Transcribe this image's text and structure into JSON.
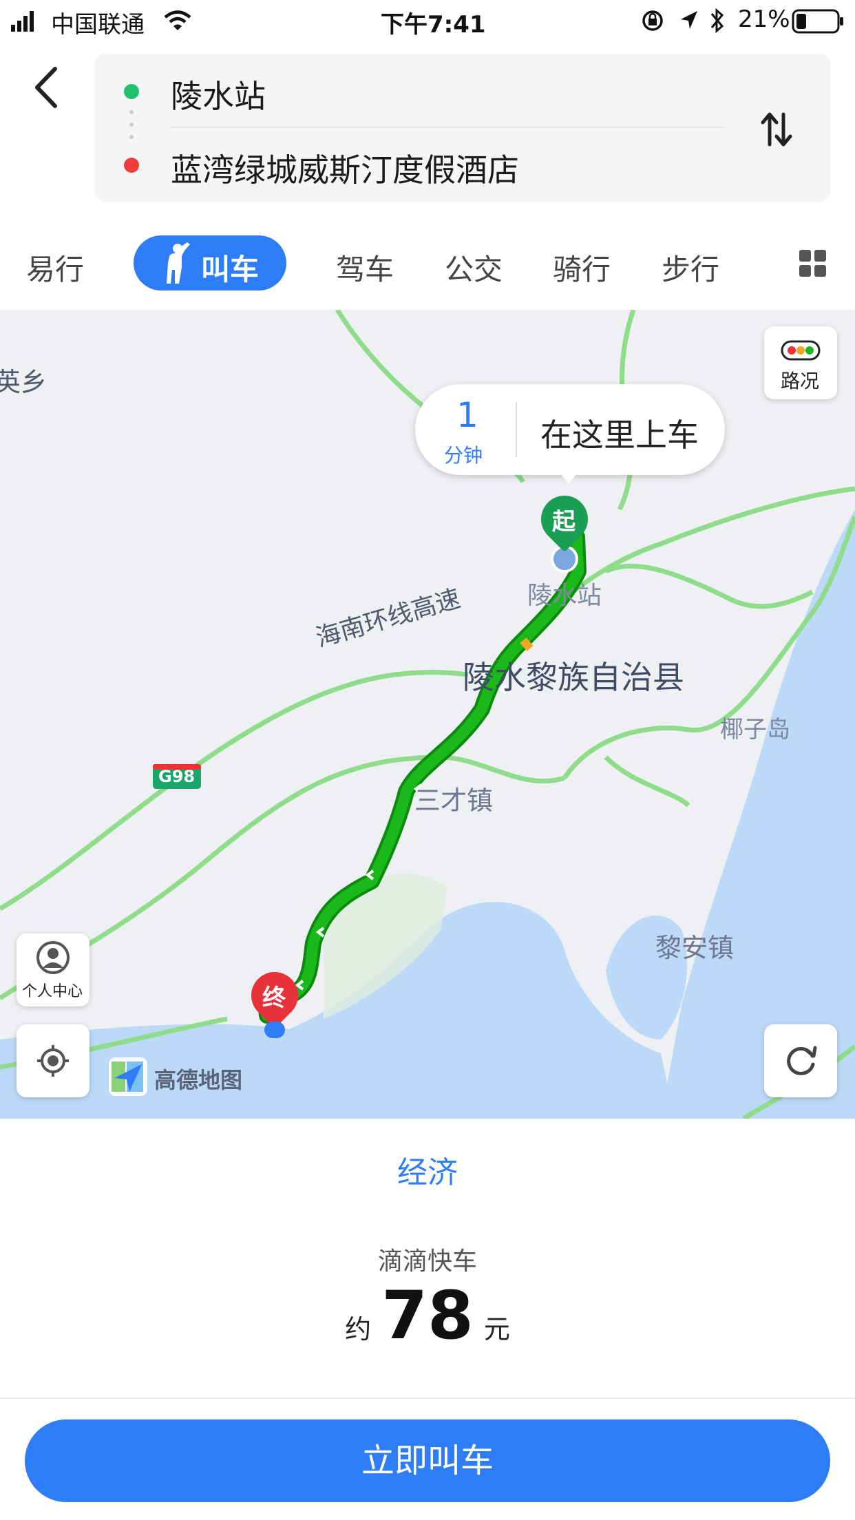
{
  "status_bar": {
    "carrier": "中国联通",
    "time": "下午7:41",
    "battery": "21%"
  },
  "route": {
    "origin": "陵水站",
    "destination": "蓝湾绿城威斯汀度假酒店"
  },
  "tabs": [
    {
      "label": "易行"
    },
    {
      "label": "叫车",
      "active": true
    },
    {
      "label": "驾车"
    },
    {
      "label": "公交"
    },
    {
      "label": "骑行"
    },
    {
      "label": "步行"
    }
  ],
  "map": {
    "pickup_minutes": "1",
    "pickup_minutes_unit": "分钟",
    "pickup_text": "在这里上车",
    "traffic_label": "路况",
    "start_marker": "起",
    "end_marker": "终",
    "user_center_label": "个人中心",
    "brand": "高德地图",
    "places": {
      "edge_label": "英乡",
      "station": "陵水站",
      "highway": "海南环线高速",
      "county": "陵水黎族自治县",
      "island": "椰子岛",
      "road_shield": "G98",
      "town1": "三才镇",
      "town2": "黎安镇"
    },
    "colors": {
      "route": "#1bb81b",
      "road": "#8fdc8a",
      "water": "#bcd9f7",
      "land": "#eef0f3"
    }
  },
  "fare": {
    "category": "经济",
    "service": "滴滴快车",
    "prefix": "约",
    "amount": "78",
    "unit": "元"
  },
  "cta": {
    "label": "立即叫车"
  },
  "accent_color": "#2f7df6"
}
